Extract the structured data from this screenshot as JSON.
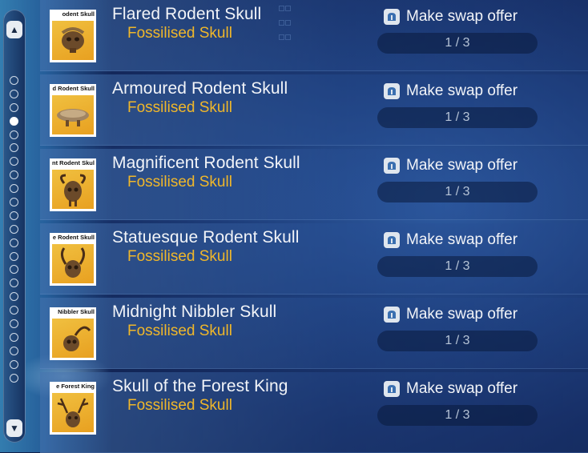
{
  "scroll": {
    "up_icon": "arrow-up-icon",
    "down_icon": "arrow-down-icon",
    "dot_count": 23,
    "active_dot_index": 3
  },
  "items": [
    {
      "thumb_label": "odent Skull",
      "name": "Flared Rodent Skull",
      "category": "Fossilised Skull",
      "action": "Make swap offer",
      "counter": "1 / 3",
      "icon": "flared-skull-icon"
    },
    {
      "thumb_label": "d Rodent Skull",
      "name": "Armoured Rodent Skull",
      "category": "Fossilised Skull",
      "action": "Make swap offer",
      "counter": "1 / 3",
      "icon": "armoured-skull-icon"
    },
    {
      "thumb_label": "nt Rodent Skull",
      "name": "Magnificent Rodent Skull",
      "category": "Fossilised Skull",
      "action": "Make swap offer",
      "counter": "1 / 3",
      "icon": "magnificent-skull-icon"
    },
    {
      "thumb_label": "e Rodent Skull",
      "name": "Statuesque Rodent Skull",
      "category": "Fossilised Skull",
      "action": "Make swap offer",
      "counter": "1 / 3",
      "icon": "statuesque-skull-icon"
    },
    {
      "thumb_label": "Nibbler Skull",
      "name": "Midnight Nibbler Skull",
      "category": "Fossilised Skull",
      "action": "Make swap offer",
      "counter": "1 / 3",
      "icon": "nibbler-skull-icon"
    },
    {
      "thumb_label": "e Forest King",
      "name": "Skull of the Forest King",
      "category": "Fossilised Skull",
      "action": "Make swap offer",
      "counter": "1 / 3",
      "icon": "forest-king-skull-icon"
    }
  ],
  "colors": {
    "title": "#f2f4f8",
    "subtitle": "#f0b72a",
    "thumb_bg": "#f0c040"
  }
}
